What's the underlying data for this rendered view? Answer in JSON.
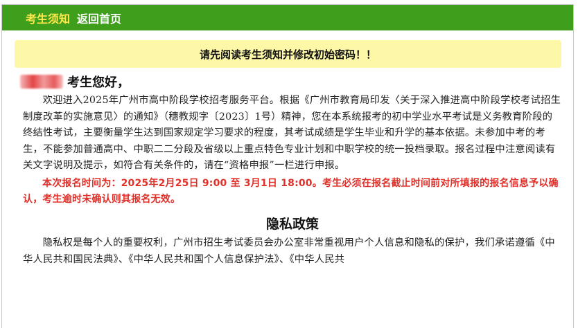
{
  "nav": {
    "notice_label": "考生须知",
    "home_label": "返回首页"
  },
  "notice": {
    "text": "请先阅读考生须知并修改初始密码！！"
  },
  "greeting": {
    "suffix": "考生您好，"
  },
  "body": {
    "para1": "欢迎进入2025年广州市高中阶段学校招考服务平台。根据《广州市教育局印发〈关于深入推进高中阶段学校考试招生制度改革的实施意见〉的通知》（穗教规字〔2023〕1号）精神，您在本系统报考的初中学业水平考试是义务教育阶段的终结性考试，主要衡量学生达到国家规定学习要求的程度，其考试成绩是学生毕业和升学的基本依据。未参加中考的考生，不能参加普通高中、中职二二分段及省级以上重点特色专业计划和中职学校的统一投档录取。报名过程中注意阅读有关文字说明及提示，如符合有关条件的，请在“资格申报”一栏进行申报。",
    "para2": "本次报名时间为：2025年2月25日 9:00 至 3月1日 18:00。考生必须在报名截止时间前对所填报的报名信息予以确认，考生逾时未确认则其报名无效。",
    "privacy_title": "隐私政策",
    "para3": "隐私权是每个人的重要权利，广州市招生考试委员会办公室非常重视用户个人信息和隐私的保护，我们承诺遵循《中华人民共和国民法典》、《中华人民共和国个人信息保护法》、《中华人民共"
  },
  "colors": {
    "topbar": "#3f9e1c",
    "nav_active": "#ffe94d",
    "notice_bg": "#fdf8a8",
    "deadline_red": "#e0302a"
  }
}
